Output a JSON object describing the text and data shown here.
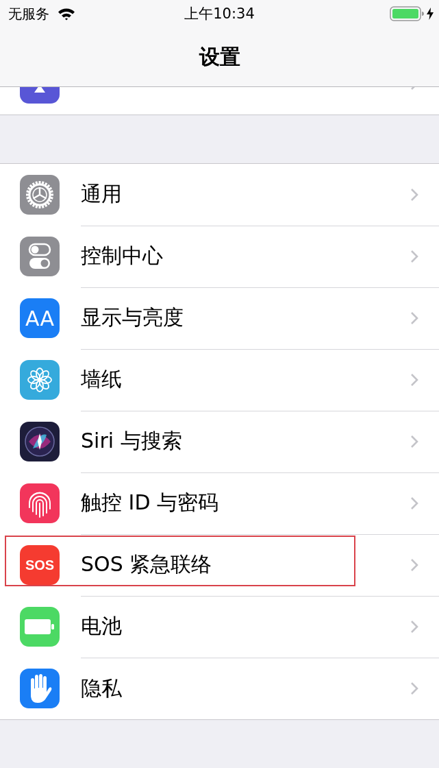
{
  "status_bar": {
    "carrier": "无服务",
    "time": "上午10:34",
    "charging": true
  },
  "nav": {
    "title": "设置"
  },
  "settings": [
    {
      "label": "通用",
      "kind": "gear",
      "color": "#8e8e93",
      "highlighted": false
    },
    {
      "label": "控制中心",
      "kind": "toggles",
      "color": "#8e8e93",
      "highlighted": false
    },
    {
      "label": "显示与亮度",
      "kind": "text",
      "icon_text": "AA",
      "color": "#1a7ef5",
      "highlighted": false
    },
    {
      "label": "墙纸",
      "kind": "flower",
      "color": "#35aadc",
      "highlighted": false
    },
    {
      "label": "Siri 与搜索",
      "kind": "siri",
      "color": "#1d1d3a",
      "highlighted": false
    },
    {
      "label": "触控 ID 与密码",
      "kind": "fingerprint",
      "color": "#f2355b",
      "highlighted": false
    },
    {
      "label": "SOS 紧急联络",
      "kind": "text",
      "icon_text": "SOS",
      "color": "#f53b30",
      "highlighted": true
    },
    {
      "label": "电池",
      "kind": "battery",
      "color": "#4cd964",
      "highlighted": false
    },
    {
      "label": "隐私",
      "kind": "hand",
      "color": "#1a7ef5",
      "highlighted": false
    }
  ]
}
